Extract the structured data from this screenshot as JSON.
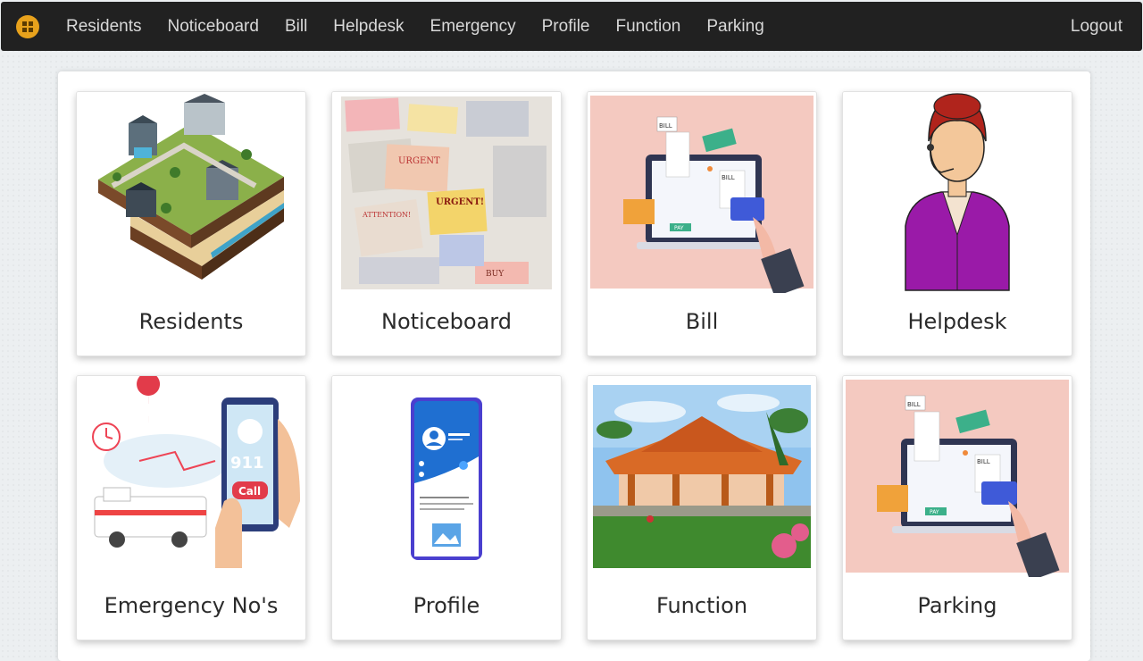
{
  "navbar": {
    "logo": "apartment-logo",
    "links": [
      "Residents",
      "Noticeboard",
      "Bill",
      "Helpdesk",
      "Emergency",
      "Profile",
      "Function",
      "Parking"
    ],
    "logout": "Logout"
  },
  "cards": [
    {
      "label": "Residents",
      "image": "isometric-houses"
    },
    {
      "label": "Noticeboard",
      "image": "paper-notices"
    },
    {
      "label": "Bill",
      "image": "laptop-bill-payment"
    },
    {
      "label": "Helpdesk",
      "image": "support-agent"
    },
    {
      "label": "Emergency No's",
      "image": "ambulance-phone-call"
    },
    {
      "label": "Profile",
      "image": "mobile-profile"
    },
    {
      "label": "Function",
      "image": "function-hall-photo"
    },
    {
      "label": "Parking",
      "image": "laptop-bill-payment"
    }
  ],
  "art_text": {
    "urgent": "URGENT!",
    "urgent2": "URGENT",
    "attention": "ATTENTION!",
    "buy": "BUY",
    "bill": "BILL",
    "pay": "PAY",
    "call": "Call",
    "num911": "911"
  },
  "colors": {
    "navbar": "#212121",
    "logo": "#e8a21c",
    "bill_bg": "#f4c9c0",
    "agent_hair": "#b0241c",
    "agent_jacket": "#9a1aa8"
  }
}
